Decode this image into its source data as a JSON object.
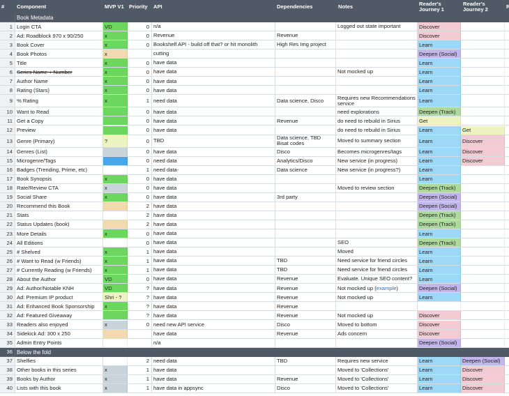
{
  "headers": {
    "num": "#",
    "component": "Component",
    "mvp": "MVP V1",
    "priority": "Priority",
    "api": "API",
    "deps": "Dependencies",
    "notes": "Notes",
    "j1": "Reader's Journey 1",
    "j2": "Reader's Journey 2",
    "j3": "R"
  },
  "colors": {
    "header_bg": "#505a66",
    "green": "#6cd65f",
    "tan": "#f3d9b0",
    "gray": "#c9d3da",
    "blue": "#4aa6e6",
    "yellow": "#eef3c2",
    "pink": "#f3cbd3",
    "learn": "#9dd9f6",
    "deepen_social": "#c3b6ea",
    "deepen_track": "#aed99c",
    "get": "#eef3c2",
    "comment": "#e8a81c"
  },
  "rows": [
    {
      "type": "section",
      "num": "",
      "label": "Book Metadata"
    },
    {
      "num": "1",
      "component": "Login CTA",
      "mvp": "VD",
      "mvpc": "green",
      "pri": "0",
      "api": "n/a",
      "deps": "",
      "notes": "Logged out state important",
      "j1": "Discover",
      "j1c": "pink",
      "j2": "",
      "j2c": "",
      "tri_api": true
    },
    {
      "num": "2",
      "component": "Ad: Roadblock 970 x 90/250",
      "mvp": "x",
      "mvpc": "green",
      "pri": "0",
      "api": "Revenue",
      "deps": "Revenue",
      "notes": "",
      "j1": "Discover",
      "j1c": "pink",
      "j2": "",
      "j2c": ""
    },
    {
      "num": "3",
      "component": "Book Cover",
      "mvp": "x",
      "mvpc": "green",
      "pri": "0",
      "api": "Bookshelf API - build off that? or hit monolith",
      "deps": "High Res Img project",
      "notes": "",
      "j1": "Learn",
      "j1c": "learn",
      "j2": "",
      "j2c": ""
    },
    {
      "num": "4",
      "component": "Book Photos",
      "mvp": "x",
      "mvpc": "tan",
      "pri": "",
      "api": "cutting",
      "deps": "",
      "notes": "",
      "j1": "Deepen (Social)",
      "j1c": "deepen_social",
      "j2": "",
      "j2c": ""
    },
    {
      "num": "5",
      "component": "Title",
      "mvp": "x",
      "mvpc": "green",
      "pri": "0",
      "api": "have data",
      "deps": "",
      "notes": "",
      "j1": "Learn",
      "j1c": "learn",
      "j2": "",
      "j2c": ""
    },
    {
      "num": "6",
      "component": "Series Name + Number",
      "strike": true,
      "mvp": "x",
      "mvpc": "green",
      "pri": "0",
      "api": "have data",
      "deps": "",
      "notes": "Not mocked up",
      "j1": "Learn",
      "j1c": "learn",
      "j2": "",
      "j2c": ""
    },
    {
      "num": "7",
      "component": "Author Name",
      "mvp": "x",
      "mvpc": "green",
      "pri": "0",
      "api": "have data",
      "deps": "",
      "notes": "",
      "j1": "Learn",
      "j1c": "learn",
      "j2": "",
      "j2c": ""
    },
    {
      "num": "8",
      "component": "Rating (Stars)",
      "mvp": "x",
      "mvpc": "green",
      "pri": "0",
      "api": "have data",
      "deps": "",
      "notes": "",
      "j1": "Learn",
      "j1c": "learn",
      "j2": "",
      "j2c": ""
    },
    {
      "num": "9",
      "component": "% Rating",
      "mvp": "x",
      "mvpc": "green",
      "pri": "1",
      "api": "need data",
      "deps": "Data science, Disco",
      "notes": "Requires new Recommendations service",
      "j1": "Learn",
      "j1c": "learn",
      "j2": "",
      "j2c": "",
      "tall": true
    },
    {
      "num": "10",
      "component": "Want to Read",
      "mvp": "",
      "mvpc": "green",
      "pri": "0",
      "api": "have data",
      "deps": "",
      "notes": "need explorations",
      "j1": "Deepen (Track)",
      "j1c": "deepen_track",
      "j2": "",
      "j2c": ""
    },
    {
      "num": "11",
      "component": "Get a Copy",
      "mvp": "",
      "mvpc": "green",
      "pri": "0",
      "api": "have data",
      "deps": "Revenue",
      "notes": "do need to rebuild in Sirius",
      "j1": "Get",
      "j1c": "get",
      "j2": "",
      "j2c": ""
    },
    {
      "num": "12",
      "component": "Preview",
      "mvp": "",
      "mvpc": "green",
      "pri": "0",
      "api": "have data",
      "deps": "",
      "notes": "do need to rebuild in Sirius",
      "j1": "Learn",
      "j1c": "learn",
      "j2": "Get",
      "j2c": "get"
    },
    {
      "num": "13",
      "component": "Genre (Primary)",
      "mvp": "?",
      "mvpc": "yellow",
      "pri": "0",
      "api": "TBD",
      "deps": "Data science, TBD Bisat codes",
      "notes": "Moved to summary section",
      "j1": "Learn",
      "j1c": "learn",
      "j2": "Discover",
      "j2c": "pink",
      "tall": true,
      "tri_mvp": true
    },
    {
      "num": "14",
      "component": "Genres (List)",
      "mvp": "",
      "mvpc": "gray",
      "pri": "0",
      "api": "have data",
      "deps": "Disco",
      "notes": "Becomes microgenres/tags",
      "j1": "Learn",
      "j1c": "learn",
      "j2": "Discover",
      "j2c": "pink"
    },
    {
      "num": "15",
      "component": "Microgenre/Tags",
      "mvp": "",
      "mvpc": "blue",
      "pri": "0",
      "api": "need data",
      "deps": "Analytics/Disco",
      "notes": "New service (in progress)",
      "j1": "Learn",
      "j1c": "learn",
      "j2": "Discover",
      "j2c": "pink"
    },
    {
      "num": "16",
      "component": "Badges (Trending, Prime, etc)",
      "mvp": "",
      "mvpc": "",
      "pri": "1",
      "api": "need data-",
      "deps": "Data science",
      "notes": "New service (in progress?)",
      "j1": "Learn",
      "j1c": "learn",
      "j2": "",
      "j2c": "",
      "tri_mvp": true
    },
    {
      "num": "17",
      "component": "Book Synopsis",
      "mvp": "x",
      "mvpc": "green",
      "pri": "0",
      "api": "have data",
      "deps": "",
      "notes": "",
      "j1": "Learn",
      "j1c": "learn",
      "j2": "",
      "j2c": ""
    },
    {
      "num": "18",
      "component": "Rate/Review CTA",
      "mvp": "x",
      "mvpc": "gray",
      "pri": "0",
      "api": "have data",
      "deps": "",
      "notes": "Moved to review section",
      "j1": "Deepen (Track)",
      "j1c": "deepen_track",
      "j2": "",
      "j2c": ""
    },
    {
      "num": "19",
      "component": "Social Share",
      "mvp": "x",
      "mvpc": "green",
      "pri": "0",
      "api": "have data",
      "deps": "3rd party",
      "notes": "",
      "j1": "Deepen (Social)",
      "j1c": "deepen_social",
      "j2": "",
      "j2c": ""
    },
    {
      "num": "20",
      "component": "Recommend this Book",
      "mvp": "",
      "mvpc": "tan",
      "pri": "2",
      "api": "have data",
      "deps": "",
      "notes": "",
      "j1": "Deepen (Social)",
      "j1c": "deepen_social",
      "j2": "",
      "j2c": ""
    },
    {
      "num": "21",
      "component": "Stats",
      "mvp": "",
      "mvpc": "",
      "pri": "2",
      "api": "have data",
      "deps": "",
      "notes": "",
      "j1": "Deepen (Track)",
      "j1c": "deepen_track",
      "j2": "",
      "j2c": ""
    },
    {
      "num": "22",
      "component": "Status Updates (book)",
      "mvp": "",
      "mvpc": "tan",
      "pri": "2",
      "api": "have data",
      "deps": "",
      "notes": "",
      "j1": "Deepen (Track)",
      "j1c": "deepen_track",
      "j2": "",
      "j2c": ""
    },
    {
      "num": "23",
      "component": "More Details",
      "mvp": "x",
      "mvpc": "green",
      "pri": "0",
      "api": "have data",
      "deps": "",
      "notes": "",
      "j1": "Learn",
      "j1c": "learn",
      "j2": "",
      "j2c": "",
      "tri_deps": true
    },
    {
      "num": "24",
      "component": "All Editions",
      "mvp": "",
      "mvpc": "",
      "pri": "0",
      "api": "have data",
      "deps": "",
      "notes": "SEO",
      "j1": "Deepen (Track)",
      "j1c": "deepen_track",
      "j2": "",
      "j2c": "",
      "tri_mvp": true
    },
    {
      "num": "25",
      "component": "# Shelved",
      "mvp": "x",
      "mvpc": "green",
      "pri": "1",
      "api": "have data",
      "deps": "",
      "notes": "Moved",
      "j1": "Learn",
      "j1c": "learn",
      "j2": "",
      "j2c": ""
    },
    {
      "num": "26",
      "component": "# Want to Read (w Friends)",
      "mvp": "x",
      "mvpc": "green",
      "pri": "1",
      "api": "have data",
      "deps": "TBD",
      "notes": "Need service for friend circles",
      "j1": "Learn",
      "j1c": "learn",
      "j2": "",
      "j2c": "",
      "tri_notes": true
    },
    {
      "num": "27",
      "component": "# Currently Reading (w Friends)",
      "mvp": "x",
      "mvpc": "green",
      "pri": "1",
      "api": "have data",
      "deps": "TBD",
      "notes": "Need service for friend circles",
      "j1": "Learn",
      "j1c": "learn",
      "j2": "",
      "j2c": ""
    },
    {
      "num": "28",
      "component": "About the Author",
      "mvp": "VD",
      "mvpc": "green",
      "pri": "0",
      "api": "have data",
      "deps": "Revenue",
      "notes": "Evaluate. Unique SEO content?",
      "j1": "Learn",
      "j1c": "learn",
      "j2": "",
      "j2c": "",
      "tri_notes": true
    },
    {
      "num": "29",
      "component": "Ad: Author/Notable KNH",
      "mvp": "VD",
      "mvpc": "green",
      "pri": "?",
      "api": "have data",
      "deps": "Revenue",
      "notes": "Not mocked up",
      "notes_link": "example",
      "j1": "Deepen (Social)",
      "j1c": "deepen_social",
      "j2": "",
      "j2c": ""
    },
    {
      "num": "30",
      "component": "Ad: Premium IP product",
      "mvp": "Shri - ?",
      "mvpc": "yellow",
      "pri": "?",
      "api": "have data",
      "deps": "Revenue",
      "notes": "Not mocked up",
      "j1": "Learn",
      "j1c": "learn",
      "j2": "",
      "j2c": ""
    },
    {
      "num": "31",
      "component": "Ad: Enhanced Book Sponsorship",
      "mvp": "x",
      "mvpc": "green",
      "pri": "?",
      "api": "have data",
      "deps": "Revenue",
      "notes": "",
      "j1": "",
      "j1c": "",
      "j2": "",
      "j2c": ""
    },
    {
      "num": "32",
      "component": "Ad: Featured Giveaway",
      "mvp": "",
      "mvpc": "green",
      "pri": "?",
      "api": "have data",
      "deps": "Revenue",
      "notes": "Not mocked up",
      "j1": "Discover",
      "j1c": "pink",
      "j2": "",
      "j2c": ""
    },
    {
      "num": "33",
      "component": "Readers also enjoyed",
      "mvp": "x",
      "mvpc": "gray",
      "pri": "0",
      "api": "need new API service",
      "deps": "Disco",
      "notes": "Moved to bottom",
      "j1": "Discover",
      "j1c": "pink",
      "j2": "",
      "j2c": ""
    },
    {
      "num": "34",
      "component": "Sidekick Ad: 300 x 250",
      "mvp": "",
      "mvpc": "tan",
      "pri": "",
      "api": "have data",
      "deps": "Revenue",
      "notes": "Ads concern",
      "j1": "Discover",
      "j1c": "pink",
      "j2": "",
      "j2c": "",
      "tri_mvp": true
    },
    {
      "num": "35",
      "component": "Admin Entry Points",
      "mvp": "",
      "mvpc": "",
      "pri": "",
      "api": "n/a",
      "deps": "",
      "notes": "",
      "j1": "Deepen (Social)",
      "j1c": "deepen_social",
      "j2": "",
      "j2c": ""
    },
    {
      "type": "section",
      "num": "36",
      "label": "Below the fold"
    },
    {
      "num": "37",
      "component": "Shelfies",
      "mvp": "",
      "mvpc": "",
      "pri": "2",
      "api": "need data",
      "deps": "TBD",
      "notes": "Requires new service",
      "j1": "Learn",
      "j1c": "learn",
      "j2": "Deepen (Social)",
      "j2c": "deepen_social"
    },
    {
      "num": "38",
      "component": "Other books in this series",
      "mvp": "x",
      "mvpc": "gray",
      "pri": "1",
      "api": "have data",
      "deps": "",
      "notes": "Moved to 'Collections'",
      "j1": "Learn",
      "j1c": "learn",
      "j2": "Discover",
      "j2c": "pink"
    },
    {
      "num": "39",
      "component": "Books by Author",
      "mvp": "x",
      "mvpc": "gray",
      "pri": "1",
      "api": "have data",
      "deps": "Revenue",
      "notes": "Moved to 'Collections'",
      "j1": "Learn",
      "j1c": "learn",
      "j2": "Discover",
      "j2c": "pink"
    },
    {
      "num": "40",
      "component": "Lists with this book",
      "mvp": "x",
      "mvpc": "gray",
      "pri": "1",
      "api": "have data in appsync",
      "deps": "Disco",
      "notes": "Moved to 'Collections'",
      "j1": "Learn",
      "j1c": "learn",
      "j2": "Discover",
      "j2c": "pink"
    }
  ]
}
